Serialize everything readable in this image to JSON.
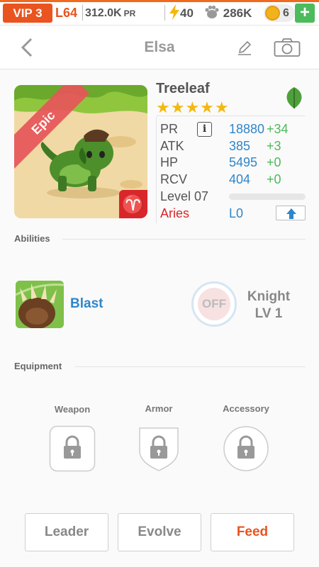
{
  "status_bar": {
    "vip": "VIP 3",
    "level": "L64",
    "pr_value": "312.0K",
    "pr_unit": "PR",
    "energy": "40",
    "paws": "286K",
    "coins": "6",
    "add_label": "+"
  },
  "header": {
    "title": "Elsa"
  },
  "creature": {
    "rarity": "Epic",
    "name": "Treeleaf",
    "stars": "★★★★★",
    "element_icon": "leaf-icon",
    "zodiac_symbol": "♈",
    "stats": [
      {
        "label": "PR",
        "value": "18880",
        "bonus": "+34"
      },
      {
        "label": "ATK",
        "value": "385",
        "bonus": "+3"
      },
      {
        "label": "HP",
        "value": "5495",
        "bonus": "+0"
      },
      {
        "label": "RCV",
        "value": "404",
        "bonus": "+0"
      }
    ],
    "info_label": "i",
    "level_text": "Level 07",
    "xp_fraction": 0.0,
    "sign_name": "Aries",
    "sign_level": "L0"
  },
  "abilities": {
    "title": "Abilities",
    "skill_name": "Blast",
    "toggle_state": "OFF",
    "class_name": "Knight",
    "class_level": "LV 1"
  },
  "equipment": {
    "title": "Equipment",
    "slots": [
      {
        "label": "Weapon"
      },
      {
        "label": "Armor"
      },
      {
        "label": "Accessory"
      }
    ]
  },
  "actions": {
    "leader": "Leader",
    "evolve": "Evolve",
    "feed": "Feed"
  },
  "colors": {
    "accent": "#e9541f",
    "blue": "#2f86c9",
    "green": "#4cbb5c",
    "red": "#d9262b",
    "star": "#f4b80f"
  }
}
